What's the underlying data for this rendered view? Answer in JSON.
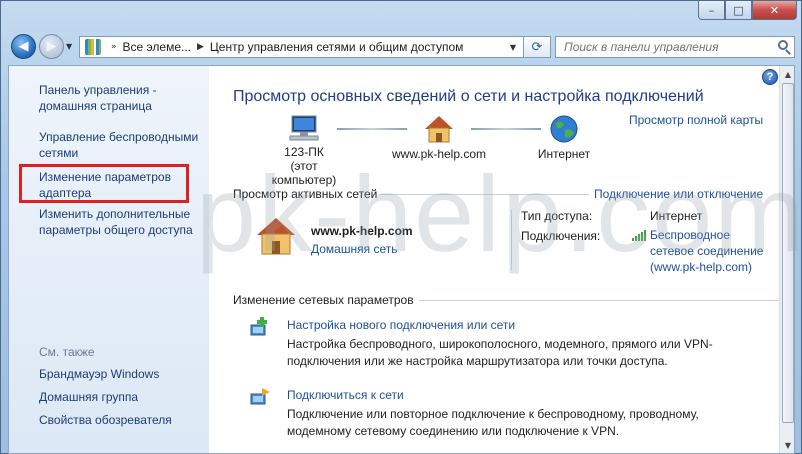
{
  "window": {
    "minimize_glyph": "–",
    "maximize_glyph": "□",
    "close_glyph": "✕"
  },
  "nav": {
    "back_icon": "back-arrow-icon",
    "forward_icon": "forward-arrow-icon",
    "breadcrumb": [
      "Все элеме...",
      "Центр управления сетями и общим доступом"
    ],
    "search_placeholder": "Поиск в панели управления"
  },
  "sidebar": {
    "home_link": "Панель управления - домашняя страница",
    "links": [
      "Управление беспроводными сетями",
      "Изменение параметров адаптера",
      "Изменить дополнительные параметры общего доступа"
    ],
    "see_also_label": "См. также",
    "see_also": [
      "Брандмауэр Windows",
      "Домашняя группа",
      "Свойства обозревателя"
    ],
    "highlight_color": "#e02020"
  },
  "main": {
    "title": "Просмотр основных сведений о сети и настройка подключений",
    "full_map_link": "Просмотр полной карты",
    "map_nodes": [
      {
        "label": "123-ПК",
        "sublabel": "(этот компьютер)",
        "icon": "computer-icon"
      },
      {
        "label": "www.pk-help.com",
        "sublabel": "",
        "icon": "house-icon"
      },
      {
        "label": "Интернет",
        "sublabel": "",
        "icon": "globe-icon"
      }
    ],
    "active_networks_heading": "Просмотр активных сетей",
    "connect_disconnect_link": "Подключение или отключение",
    "network": {
      "name": "www.pk-help.com",
      "type_link": "Домашняя сеть",
      "access_type_label": "Тип доступа:",
      "access_type_value": "Интернет",
      "connections_label": "Подключения:",
      "connection_value": [
        "Беспроводное",
        "сетевое соединение",
        "(www.pk-help.com)"
      ]
    },
    "change_settings_heading": "Изменение сетевых параметров",
    "tasks": [
      {
        "title": "Настройка нового подключения или сети",
        "description": "Настройка беспроводного, широкополосного, модемного, прямого или VPN-подключения или же настройка маршрутизатора или точки доступа.",
        "icon": "new-connection-icon"
      },
      {
        "title": "Подключиться к сети",
        "description": "Подключение или повторное подключение к беспроводному, проводному, модемному сетевому соединению или подключение к VPN.",
        "icon": "connect-network-icon"
      }
    ]
  },
  "watermark": "pk-help.com"
}
